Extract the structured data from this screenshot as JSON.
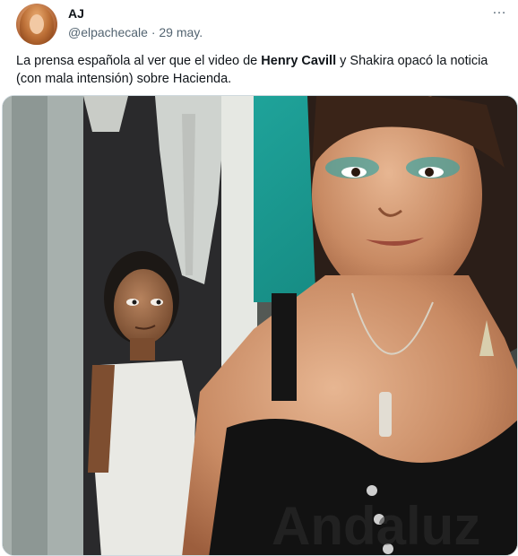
{
  "tweet": {
    "author_name": "AJ",
    "handle": "@elpachecale",
    "separator": " · ",
    "date": "29 may.",
    "more_icon": "…",
    "text": {
      "part1": "La prensa española al ver que el video de ",
      "bold": "Henry Cavill",
      "part2": " y Shakira opacó la noticia (con mala intensión) sobre Hacienda."
    },
    "media": {
      "shirt_text": "Andaluz"
    }
  },
  "icons": {
    "more": "more-horizontal-icon"
  }
}
